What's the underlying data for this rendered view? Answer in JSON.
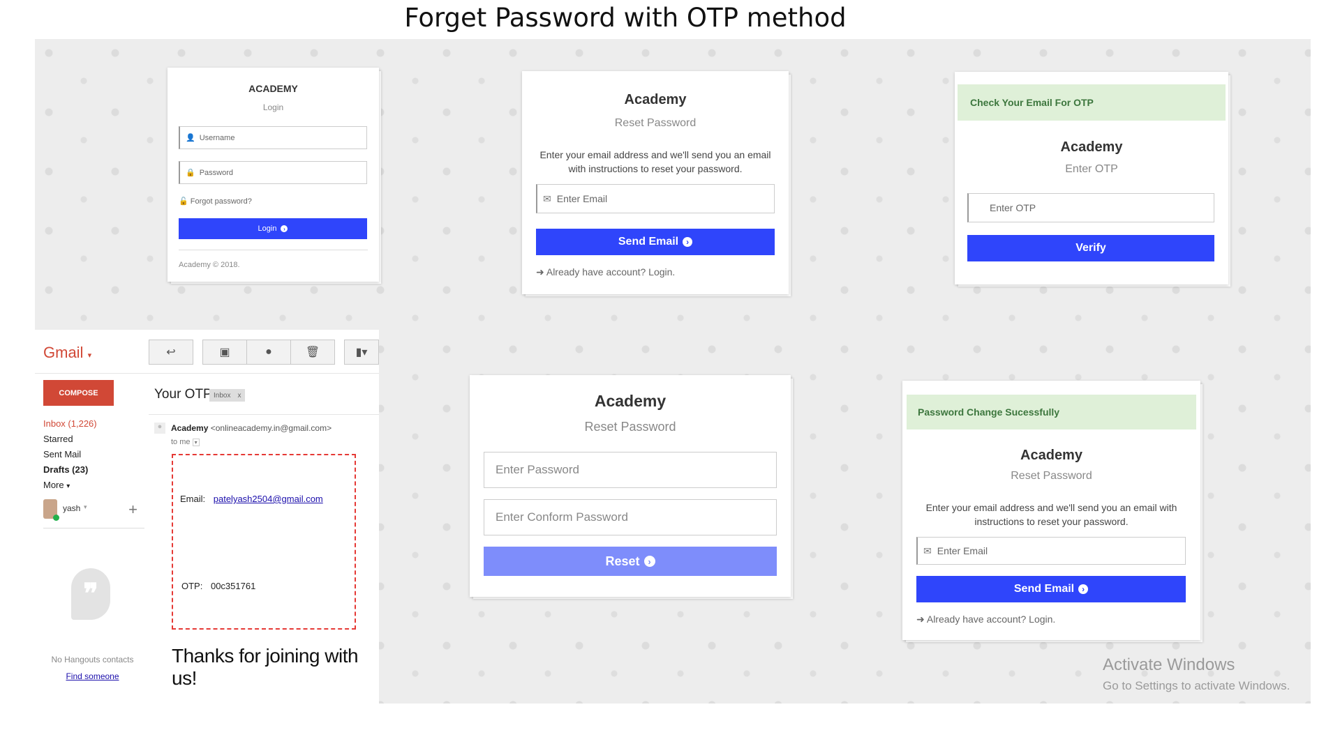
{
  "heading": "Forget Password with OTP method",
  "login_card": {
    "title": "ACADEMY",
    "subtitle": "Login",
    "username_placeholder": "Username",
    "password_placeholder": "Password",
    "forgot_link": "Forgot password?",
    "login_button": "Login",
    "footer": "Academy © 2018."
  },
  "reset_email_card": {
    "title": "Academy",
    "subtitle": "Reset Password",
    "description": "Enter your email address and we'll send you an email with instructions to reset your password.",
    "email_placeholder": "Enter Email",
    "send_button": "Send Email",
    "login_link": "Already have account? Login."
  },
  "otp_card": {
    "alert": "Check Your Email For OTP",
    "title": "Academy",
    "subtitle": "Enter OTP",
    "otp_placeholder": "Enter OTP",
    "verify_button": "Verify"
  },
  "new_password_card": {
    "title": "Academy",
    "subtitle": "Reset Password",
    "password_placeholder": "Enter Password",
    "confirm_placeholder": "Enter Conform Password",
    "reset_button": "Reset"
  },
  "success_card": {
    "alert": "Password Change Sucessfully",
    "title": "Academy",
    "subtitle": "Reset Password",
    "description": "Enter your email address and we'll send you an email with instructions to reset your password.",
    "email_placeholder": "Enter Email",
    "send_button": "Send Email",
    "login_link": "Already have account? Login."
  },
  "gmail": {
    "logo": "Gmail",
    "compose": "COMPOSE",
    "folders": [
      {
        "label": "Inbox (1,226)"
      },
      {
        "label": "Starred"
      },
      {
        "label": "Sent Mail"
      },
      {
        "label": "Drafts (23)"
      },
      {
        "label": "More"
      }
    ],
    "user": "yash",
    "hangouts_empty": "No Hangouts contacts",
    "find_someone": "Find someone",
    "subject": "Your OTP",
    "label_chip": "Inbox",
    "chip_close": "x",
    "sender_name": "Academy",
    "sender_email": "<onlineacademy.in@gmail.com>",
    "to_me": "to me",
    "email_label": "Email:",
    "email_value": "patelyash2504@gmail.com",
    "otp_label": "OTP:",
    "otp_value": "00c351761",
    "thanks": "Thanks for joining with us!"
  },
  "activation": {
    "title": "Activate Windows",
    "subtitle": "Go to Settings to activate Windows."
  }
}
